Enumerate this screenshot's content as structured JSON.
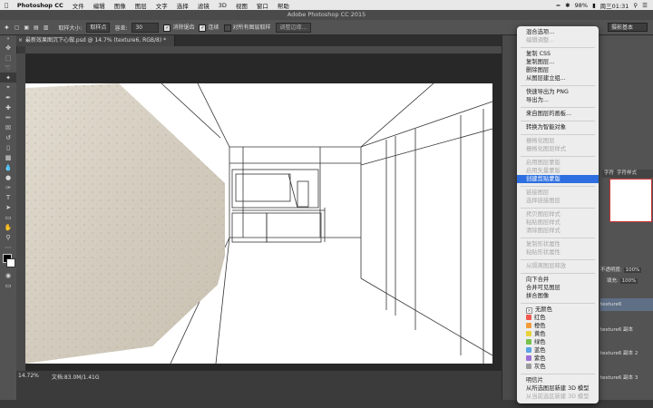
{
  "menubar": {
    "app": "Photoshop CC",
    "items": [
      "文件",
      "编辑",
      "图像",
      "图层",
      "文字",
      "选择",
      "滤镜",
      "3D",
      "视图",
      "窗口",
      "帮助"
    ],
    "battery": "98%",
    "clock": "周三01:31"
  },
  "titlebar": {
    "title": "Adobe Photoshop CC 2015"
  },
  "options": {
    "size_label": "取样大小:",
    "size_value": "取样点",
    "tolerance_label": "容差:",
    "tolerance_value": "30",
    "antialias_label": "消除锯齿",
    "contiguous_label": "连续",
    "sample_all_label": "对所有图层取样",
    "refine_button": "调整边缘...",
    "workspace": "摄影基本"
  },
  "document": {
    "tab_title": "最新效果图沉下心做.psd @ 14.7% (texture6, RGB/8) *"
  },
  "status": {
    "zoom": "14.72%",
    "doc_size": "文档:83.0M/1.41G"
  },
  "right_panel": {
    "tabs": [
      "字符",
      "字符样式"
    ],
    "opacity_label": "不透明度:",
    "opacity_value": "100%",
    "fill_label": "填充:",
    "fill_value": "100%",
    "layers": [
      "texture6",
      "texture6 副本",
      "texture6 副本 2",
      "texture6 副本 3"
    ]
  },
  "context_menu": {
    "items": [
      {
        "label": "混合选项...",
        "disabled": false
      },
      {
        "label": "编辑调整...",
        "disabled": true
      },
      {
        "label": "复制 CSS",
        "disabled": false
      },
      {
        "label": "复制图层...",
        "disabled": false
      },
      {
        "label": "删除图层",
        "disabled": false
      },
      {
        "label": "从图层建立组...",
        "disabled": false
      },
      {
        "label": "快速导出为 PNG",
        "disabled": false
      },
      {
        "label": "导出为...",
        "disabled": false
      },
      {
        "label": "来自图层的画板...",
        "disabled": false
      },
      {
        "label": "转换为智能对象",
        "disabled": false
      },
      {
        "label": "栅格化图层",
        "disabled": true
      },
      {
        "label": "栅格化图层样式",
        "disabled": true
      },
      {
        "label": "启用图层蒙版",
        "disabled": true
      },
      {
        "label": "启用矢量蒙版",
        "disabled": true
      },
      {
        "label": "创建剪贴蒙版",
        "disabled": false,
        "highlighted": true
      },
      {
        "label": "链接图层",
        "disabled": true
      },
      {
        "label": "选择链接图层",
        "disabled": true
      },
      {
        "label": "拷贝图层样式",
        "disabled": true
      },
      {
        "label": "粘贴图层样式",
        "disabled": true
      },
      {
        "label": "清除图层样式",
        "disabled": true
      },
      {
        "label": "复制形状属性",
        "disabled": true
      },
      {
        "label": "粘贴形状属性",
        "disabled": true
      },
      {
        "label": "从隔离图层释放",
        "disabled": true
      },
      {
        "label": "向下合并",
        "disabled": false
      },
      {
        "label": "合并可见图层",
        "disabled": false
      },
      {
        "label": "拼合图像",
        "disabled": false
      },
      {
        "label": "无颜色",
        "disabled": false,
        "swatch": "none"
      },
      {
        "label": "红色",
        "disabled": false,
        "swatch": "#f05a4f"
      },
      {
        "label": "橙色",
        "disabled": false,
        "swatch": "#f59a3b"
      },
      {
        "label": "黄色",
        "disabled": false,
        "swatch": "#e8d23a"
      },
      {
        "label": "绿色",
        "disabled": false,
        "swatch": "#76c24d"
      },
      {
        "label": "蓝色",
        "disabled": false,
        "swatch": "#5aa4e6"
      },
      {
        "label": "紫色",
        "disabled": false,
        "swatch": "#9c6fd6"
      },
      {
        "label": "灰色",
        "disabled": false,
        "swatch": "#9a9a9a"
      },
      {
        "label": "明信片",
        "disabled": false
      },
      {
        "label": "从所选图层新建 3D 模型",
        "disabled": false
      },
      {
        "label": "从当前选区新建 3D 模型",
        "disabled": true
      }
    ]
  }
}
